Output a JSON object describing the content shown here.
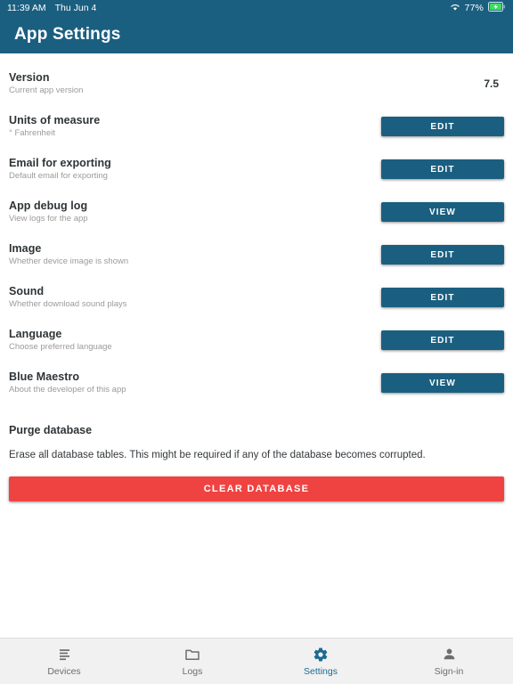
{
  "status_bar": {
    "time": "11:39 AM",
    "date": "Thu Jun 4",
    "wifi_icon": "wifi-icon",
    "battery_percent": "77%",
    "battery_icon": "battery-charging-icon",
    "background_color": "#1b5f80"
  },
  "app_bar": {
    "title": "App Settings",
    "background_color": "#1b5f80"
  },
  "settings": {
    "rows": [
      {
        "title": "Version",
        "subtitle": "Current app version",
        "value": "7.5",
        "action": null
      },
      {
        "title": "Units of measure",
        "subtitle": "° Fahrenheit",
        "value": null,
        "action": "EDIT"
      },
      {
        "title": "Email for exporting",
        "subtitle": "Default email for exporting",
        "value": null,
        "action": "EDIT"
      },
      {
        "title": "App debug log",
        "subtitle": "View logs for the app",
        "value": null,
        "action": "VIEW"
      },
      {
        "title": "Image",
        "subtitle": "Whether device image is shown",
        "value": null,
        "action": "EDIT"
      },
      {
        "title": "Sound",
        "subtitle": "Whether download sound plays",
        "value": null,
        "action": "EDIT"
      },
      {
        "title": "Language",
        "subtitle": "Choose preferred language",
        "value": null,
        "action": "EDIT"
      },
      {
        "title": "Blue Maestro",
        "subtitle": "About the developer of this app",
        "value": null,
        "action": "VIEW"
      }
    ]
  },
  "purge": {
    "title": "Purge database",
    "description": "Erase all database tables. This might be required if any of the database becomes corrupted.",
    "button_label": "CLEAR DATABASE",
    "button_color": "#ef4341"
  },
  "bottom_nav": {
    "active_color": "#1b6a92",
    "inactive_color": "#6d6d6d",
    "items": [
      {
        "label": "Devices",
        "icon": "list-lines-icon",
        "active": false
      },
      {
        "label": "Logs",
        "icon": "folder-icon",
        "active": false
      },
      {
        "label": "Settings",
        "icon": "gear-icon",
        "active": true
      },
      {
        "label": "Sign-in",
        "icon": "person-icon",
        "active": false
      }
    ]
  },
  "theme": {
    "primary": "#1b5f80",
    "danger": "#ef4341",
    "title_text": "#2f3437",
    "subtitle_text": "#9b9b9b"
  }
}
